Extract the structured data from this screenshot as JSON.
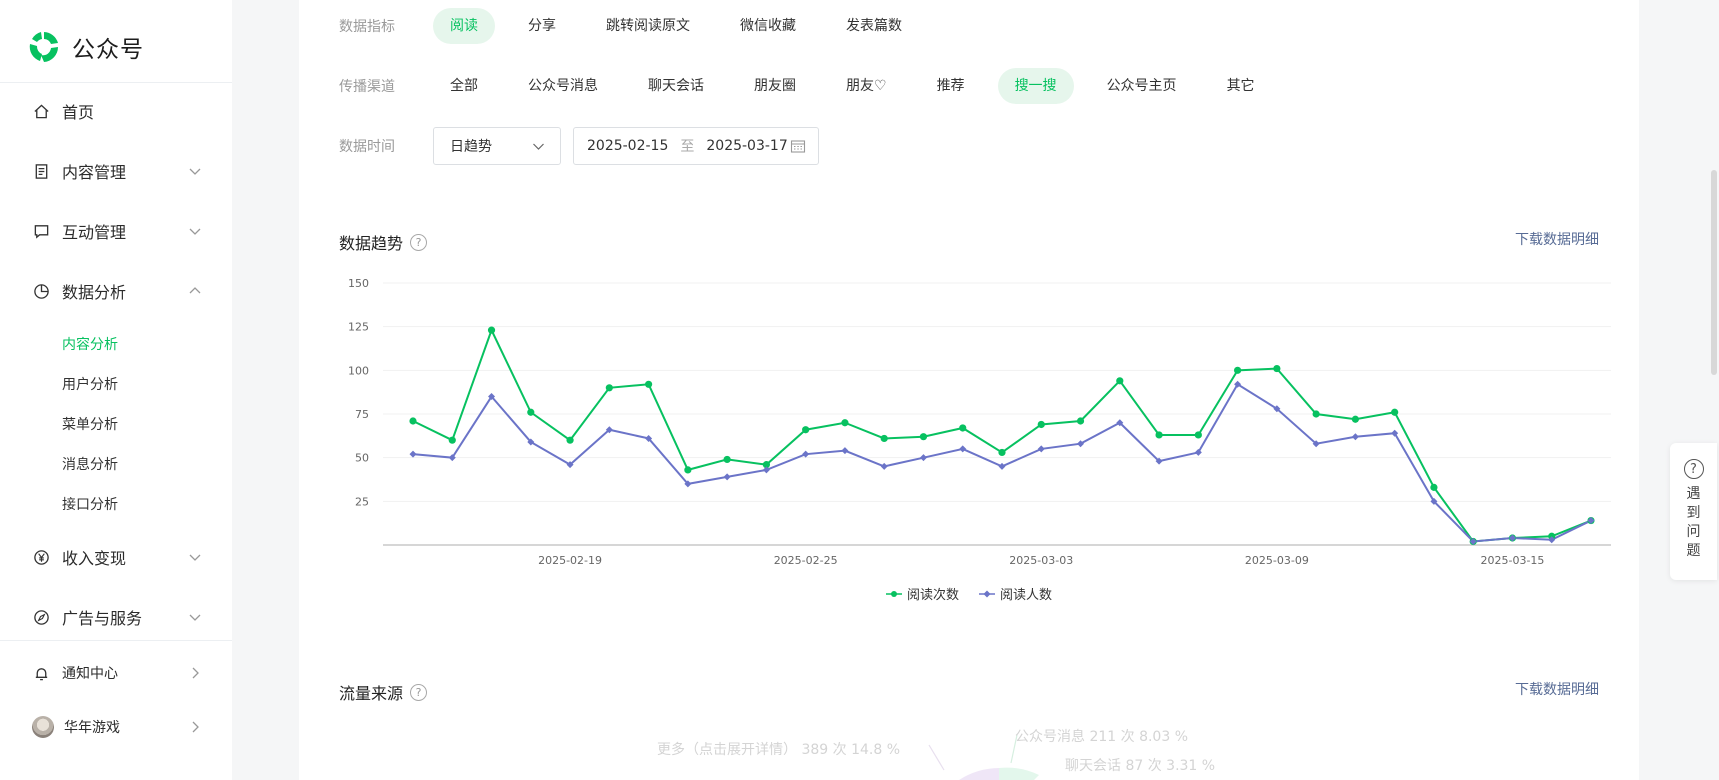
{
  "brand": {
    "name": "公众号",
    "color": "#07c160"
  },
  "sidebar": {
    "items": [
      {
        "label": "首页",
        "icon": "home-icon"
      },
      {
        "label": "内容管理",
        "icon": "document-icon"
      },
      {
        "label": "互动管理",
        "icon": "message-icon"
      },
      {
        "label": "数据分析",
        "icon": "pie-chart-icon"
      },
      {
        "label": "收入变现",
        "icon": "yen-icon"
      },
      {
        "label": "广告与服务",
        "icon": "compass-icon"
      },
      {
        "label": "通知中心",
        "icon": "bell-icon"
      },
      {
        "label": "华年游戏",
        "icon": "avatar"
      }
    ],
    "data_sub": [
      "内容分析",
      "用户分析",
      "菜单分析",
      "消息分析",
      "接口分析"
    ],
    "active_sub": "内容分析"
  },
  "filters": {
    "metric_label": "数据指标",
    "metrics": [
      "阅读",
      "分享",
      "跳转阅读原文",
      "微信收藏",
      "发表篇数"
    ],
    "metric_active": "阅读",
    "channel_label": "传播渠道",
    "channels": [
      "全部",
      "公众号消息",
      "聊天会话",
      "朋友圈",
      "朋友♡",
      "推荐",
      "搜一搜",
      "公众号主页",
      "其它"
    ],
    "channel_active": "搜一搜",
    "time_label": "数据时间",
    "trend_select": "日趋势",
    "date_start": "2025-02-15",
    "date_sep": "至",
    "date_end": "2025-03-17"
  },
  "trend": {
    "title": "数据趋势",
    "help": "?",
    "download": "下载数据明细"
  },
  "chart_data": {
    "type": "line",
    "x": [
      "2025-02-15",
      "2025-02-16",
      "2025-02-17",
      "2025-02-18",
      "2025-02-19",
      "2025-02-20",
      "2025-02-21",
      "2025-02-22",
      "2025-02-23",
      "2025-02-24",
      "2025-02-25",
      "2025-02-26",
      "2025-02-27",
      "2025-02-28",
      "2025-03-01",
      "2025-03-02",
      "2025-03-03",
      "2025-03-04",
      "2025-03-05",
      "2025-03-06",
      "2025-03-07",
      "2025-03-08",
      "2025-03-09",
      "2025-03-10",
      "2025-03-11",
      "2025-03-12",
      "2025-03-13",
      "2025-03-14",
      "2025-03-15",
      "2025-03-16",
      "2025-03-17"
    ],
    "xticks": [
      "2025-02-19",
      "2025-02-25",
      "2025-03-03",
      "2025-03-09",
      "2025-03-15"
    ],
    "yticks": [
      25,
      50,
      75,
      100,
      125,
      150
    ],
    "ylim": [
      0,
      150
    ],
    "series": [
      {
        "name": "阅读次数",
        "color": "#07c160",
        "marker": "circle",
        "values": [
          71,
          60,
          123,
          76,
          60,
          90,
          92,
          43,
          49,
          46,
          66,
          70,
          61,
          62,
          67,
          53,
          69,
          71,
          94,
          63,
          63,
          100,
          101,
          75,
          72,
          76,
          33,
          2,
          4,
          5,
          14
        ]
      },
      {
        "name": "阅读人数",
        "color": "#6b74c8",
        "marker": "diamond",
        "values": [
          52,
          50,
          85,
          59,
          46,
          66,
          61,
          35,
          39,
          43,
          52,
          54,
          45,
          50,
          55,
          45,
          55,
          58,
          70,
          48,
          53,
          92,
          78,
          58,
          62,
          64,
          25,
          2,
          4,
          3,
          14
        ]
      }
    ],
    "grid": true,
    "legend": "bottom-center"
  },
  "traffic": {
    "title": "流量来源",
    "help": "?",
    "download": "下载数据明细"
  },
  "pie_labels": {
    "more": "更多（点击展开详情） 389 次 14.8 %",
    "official": "公众号消息 211 次 8.03 %",
    "chat": "聊天会话 87 次 3.31 %"
  },
  "help_widget": {
    "icon": "?",
    "text": "遇到问题"
  }
}
